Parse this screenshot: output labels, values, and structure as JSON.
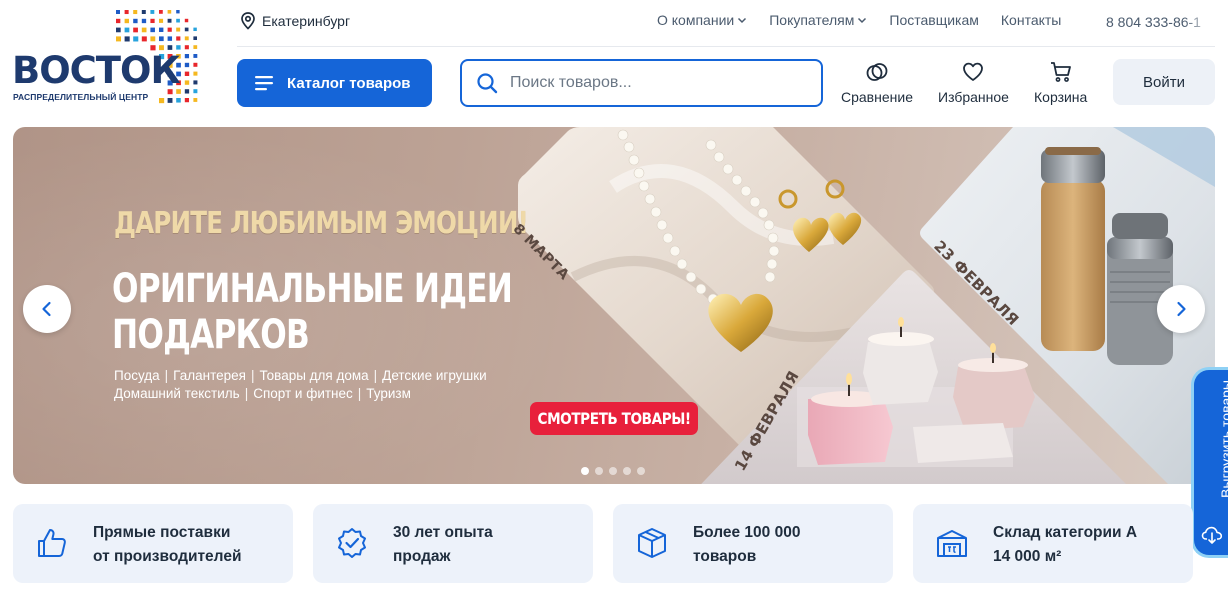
{
  "logo": {
    "name": "ВОСТОК",
    "subtitle": "РАСПРЕДЕЛИТЕЛЬНЫЙ ЦЕНТР"
  },
  "header": {
    "city": "Екатеринбург",
    "nav": [
      {
        "label": "О компании",
        "dropdown": true
      },
      {
        "label": "Покупателям",
        "dropdown": true
      },
      {
        "label": "Поставщикам",
        "dropdown": false
      },
      {
        "label": "Контакты",
        "dropdown": false
      }
    ],
    "phone": "8 804 333-86-1",
    "catalog_label": "Каталог товаров",
    "search_placeholder": "Поиск товаров...",
    "compare_label": "Сравнение",
    "favorites_label": "Избранное",
    "cart_label": "Корзина",
    "login_label": "Войти"
  },
  "banner": {
    "slogan": "ДАРИТЕ ЛЮБИМЫМ ЭМОЦИИ!",
    "headline_line1": "ОРИГИНАЛЬНЫЕ ИДЕИ",
    "headline_line2": "ПОДАРКОВ",
    "categories_line1": [
      "Посуда",
      "Галантерея",
      "Товары для дома",
      "Детские игрушки"
    ],
    "categories_line2": [
      "Домашний текстиль",
      "Спорт и фитнес",
      "Туризм"
    ],
    "cta_label": "СМОТРЕТЬ ТОВАРЫ!",
    "dates": {
      "march": "8 МАРТА",
      "feb23": "23 ФЕВРАЛЯ",
      "feb14": "14 ФЕВРАЛЯ"
    },
    "slides_total": 5,
    "active_slide": 1
  },
  "side_tab": {
    "label": "Выгрузить товары"
  },
  "features": [
    {
      "icon": "thumbs-up-icon",
      "line1": "Прямые поставки",
      "line2": "от производителей"
    },
    {
      "icon": "verified-badge-icon",
      "line1": "30 лет опыта",
      "line2": "продаж"
    },
    {
      "icon": "box-icon",
      "line1": "Более 100 000",
      "line2": "товаров"
    },
    {
      "icon": "warehouse-icon",
      "line1": "Склад категории А",
      "line2": "14 000 м²"
    }
  ],
  "colors": {
    "primary": "#1565d8",
    "brand_dark": "#1e3a6e",
    "cta_red": "#e8203b",
    "feature_bg": "#edf2fa"
  }
}
